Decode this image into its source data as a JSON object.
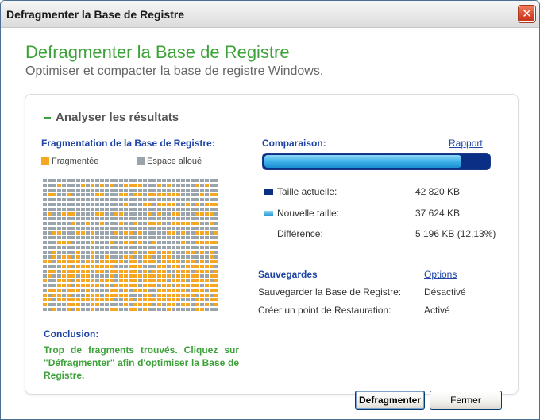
{
  "window": {
    "title": "Defragmenter la Base de Registre",
    "close_label": "✕"
  },
  "header": {
    "title": "Defragmenter la Base de Registre",
    "subtitle": "Optimiser et compacter la base de registre Windows."
  },
  "analysis": {
    "section_title": "Analyser les résultats",
    "fragmentation_title": "Fragmentation de la Base de Registre:",
    "legend": {
      "fragmented": "Fragmentée",
      "allocated": "Espace alloué"
    },
    "conclusion_title": "Conclusion:",
    "conclusion_text": "Trop de fragments trouvés. Cliquez sur \"Défragmenter\" afin d'optimiser la Base de Registre."
  },
  "comparison": {
    "title": "Comparaison:",
    "report_link": "Rapport",
    "new_size_fraction": 0.879,
    "current_size_label": "Taille actuelle:",
    "current_size_value": "42 820 KB",
    "new_size_label": "Nouvelle taille:",
    "new_size_value": "37 624 KB",
    "difference_label": "Différence:",
    "difference_value": "5 196 KB (12,13%)"
  },
  "backups": {
    "title": "Sauvegardes",
    "options_link": "Options",
    "registry_backup_label": "Sauvegarder la Base de Registre:",
    "registry_backup_value": "Désactivé",
    "restore_point_label": "Créer un point de Restauration:",
    "restore_point_value": "Activé"
  },
  "buttons": {
    "defragment": "Defragmenter",
    "close": "Fermer"
  },
  "colors": {
    "accent_green": "#3ea23a",
    "link_blue": "#1e44a6",
    "fragmented": "#f5a623",
    "allocated": "#9aa4ac",
    "current_size": "#0a2f85",
    "new_size": "#3fb2ea"
  }
}
